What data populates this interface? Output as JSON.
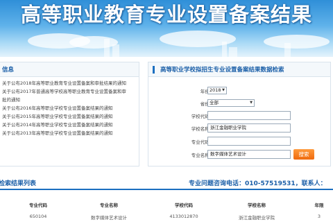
{
  "banner": {
    "title": "高等职业教育专业设置备案结果"
  },
  "news": {
    "title": "信息",
    "items": [
      "关于公布2018年高等职业教育专业设置备案和审批结果的通知",
      "关于公布2017年普通高等学校高等职业教育专业设置备案和审",
      "批的通知",
      "关于公布2016年高等职业学校专业设置备案结果的通知",
      "关于公布2015年高等职业学校专业设置备案结果的通知",
      "关于公布2014年高等职业学校专业设置备案结果的通知",
      "关于公布2013年高等职业学校专业设置备案结果的通知"
    ]
  },
  "search": {
    "title": "高等职业学校拟招生专业设置备案结果数据检索",
    "year_label": "年份:",
    "year_value": "2018",
    "province_label": "省份:",
    "province_value": "全部",
    "school_code_label": "学校代码:",
    "school_code_value": "",
    "school_name_label": "学校名称:",
    "school_name_value": "浙江金融职业学院",
    "major_code_label": "专业代码:",
    "major_code_value": "",
    "major_name_label": "专业名称:",
    "major_name_value": "数字媒体艺术设计",
    "button_label": "搜索"
  },
  "results": {
    "title": "检索结果列表",
    "hotline": "专业问题咨询电话：010-57519531，联系人：",
    "headers": [
      "专业代码",
      "专业名称",
      "学校代码",
      "学校名称",
      "年限"
    ],
    "rows": [
      [
        "650104",
        "数字媒体艺术设计",
        "4133012870",
        "浙江金融职业学院",
        "3"
      ]
    ]
  },
  "colors": {
    "accent": "#1b6fc0",
    "button": "#f06a0e",
    "banner": "#5fb2ea"
  }
}
